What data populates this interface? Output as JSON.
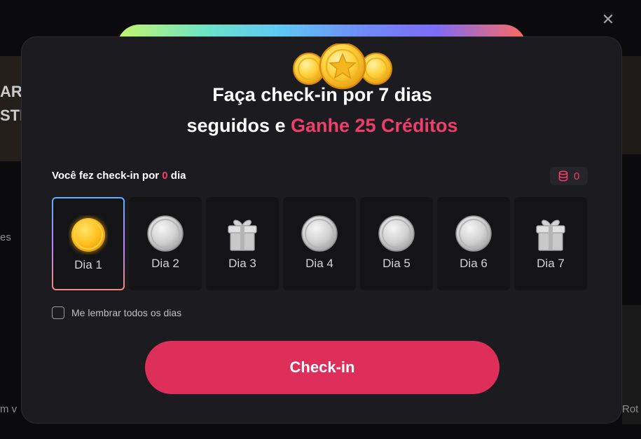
{
  "modal": {
    "close_icon": "close-icon",
    "header_icon": "coins-stack-icon",
    "title_line1": "Faça check-in por 7 dias",
    "title_line2_prefix": "seguidos e ",
    "title_line2_accent": "Ganhe 25 Créditos",
    "progress_prefix": "Você fez check-in por ",
    "progress_count": "0",
    "progress_suffix": " dia",
    "credits_icon": "database-coins-icon",
    "credits_value": "0",
    "days": [
      {
        "label": "Dia 1",
        "icon": "gold-coin-icon",
        "active": true
      },
      {
        "label": "Dia 2",
        "icon": "silver-coin-icon",
        "active": false
      },
      {
        "label": "Dia 3",
        "icon": "gift-icon",
        "active": false
      },
      {
        "label": "Dia 4",
        "icon": "silver-coin-icon",
        "active": false
      },
      {
        "label": "Dia 5",
        "icon": "silver-coin-icon",
        "active": false
      },
      {
        "label": "Dia 6",
        "icon": "silver-coin-icon",
        "active": false
      },
      {
        "label": "Dia 7",
        "icon": "gift-icon",
        "active": false
      }
    ],
    "remind_label": "Me lembrar todos os dias",
    "remind_checked": false,
    "checkin_button": "Check-in"
  },
  "background": {
    "fragments": [
      "ARK",
      "STI",
      "es",
      "m v",
      "Rot"
    ]
  },
  "colors": {
    "accent": "#f03e6c",
    "button": "#de2e5a",
    "modal_bg": "#1c1c20"
  }
}
